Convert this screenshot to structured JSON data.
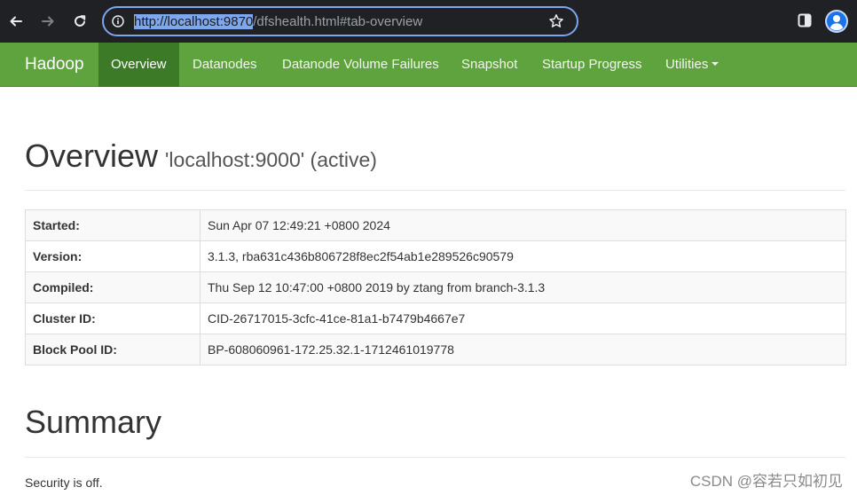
{
  "browser": {
    "url_selected": "http://localhost:9870",
    "url_rest": "/dfshealth.html#tab-overview"
  },
  "navbar": {
    "brand": "Hadoop",
    "items": [
      {
        "label": "Overview",
        "active": true
      },
      {
        "label": "Datanodes"
      },
      {
        "label": "Datanode Volume Failures"
      },
      {
        "label": "Snapshot"
      },
      {
        "label": "Startup Progress"
      },
      {
        "label": "Utilities",
        "dropdown": true
      }
    ]
  },
  "overview": {
    "title": "Overview",
    "subtitle": "'localhost:9000' (active)",
    "rows": [
      {
        "label": "Started:",
        "value": "Sun Apr 07 12:49:21 +0800 2024"
      },
      {
        "label": "Version:",
        "value": "3.1.3, rba631c436b806728f8ec2f54ab1e289526c90579"
      },
      {
        "label": "Compiled:",
        "value": "Thu Sep 12 10:47:00 +0800 2019 by ztang from branch-3.1.3"
      },
      {
        "label": "Cluster ID:",
        "value": "CID-26717015-3cfc-41ce-81a1-b7479b4667e7"
      },
      {
        "label": "Block Pool ID:",
        "value": "BP-608060961-172.25.32.1-1712461019778"
      }
    ]
  },
  "summary": {
    "title": "Summary",
    "security": "Security is off."
  },
  "watermark": "CSDN @容若只如初见",
  "colors": {
    "navbar": "#5fa33e",
    "navbar_active": "#3d7a27",
    "browser_bar": "#202124",
    "url_highlight": "#7fa8ec"
  }
}
